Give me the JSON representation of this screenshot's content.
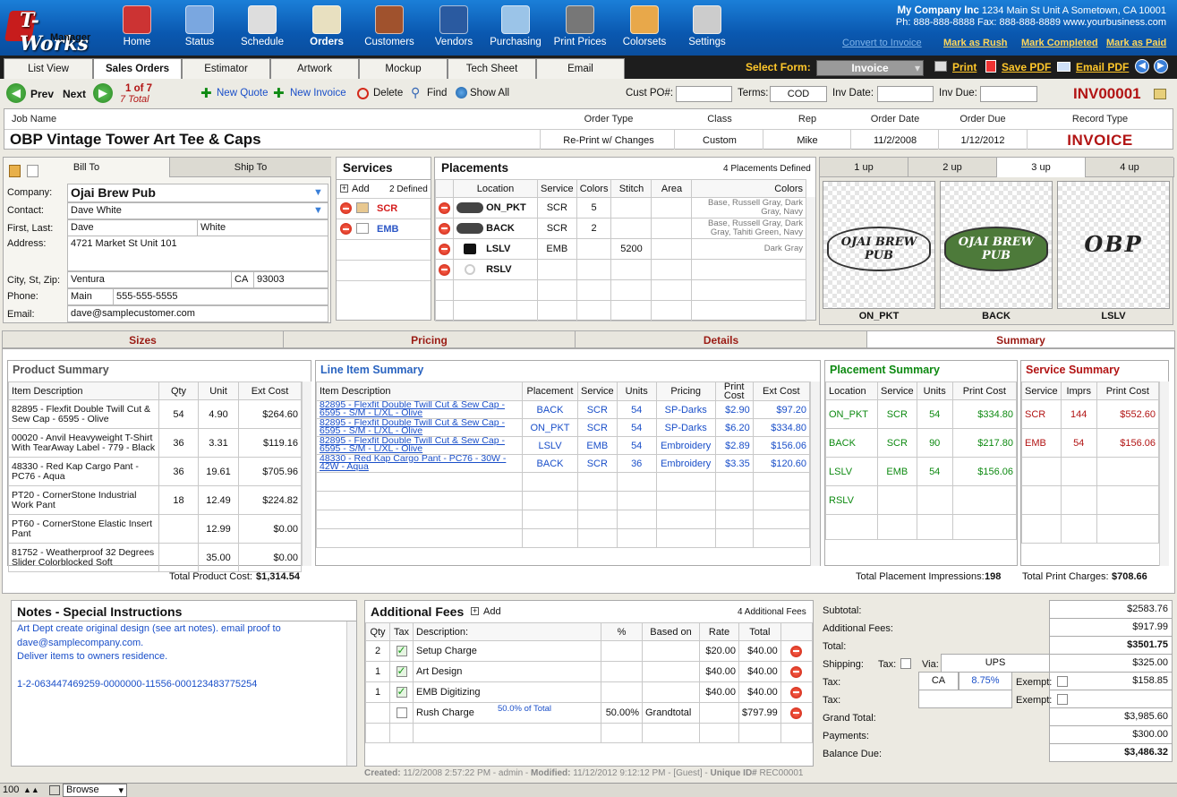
{
  "app": {
    "logo_main": "T-Works",
    "logo_sub": "Manager"
  },
  "toolbar": [
    {
      "label": "Home",
      "icon": "home-icon",
      "color": "#c33"
    },
    {
      "label": "Status",
      "icon": "flag-icon",
      "color": "#7aa7e0"
    },
    {
      "label": "Schedule",
      "icon": "calendar-icon",
      "color": "#ddd",
      "extra": "30"
    },
    {
      "label": "Orders",
      "icon": "orders-icon",
      "color": "#e8e0c0"
    },
    {
      "label": "Customers",
      "icon": "address-book-icon",
      "color": "#a0522d"
    },
    {
      "label": "Vendors",
      "icon": "shirt-icon",
      "color": "#2a5aa0"
    },
    {
      "label": "Purchasing",
      "icon": "basket-icon",
      "color": "#9bc4e8"
    },
    {
      "label": "Print Prices",
      "icon": "calculator-icon",
      "color": "#777"
    },
    {
      "label": "Colorsets",
      "icon": "palette-icon",
      "color": "#e8a84a"
    },
    {
      "label": "Settings",
      "icon": "settings-icon",
      "color": "#ccc"
    }
  ],
  "company": {
    "name": "My Company Inc",
    "address": "1234 Main St Unit A Sometown, CA 10001",
    "phone": "Ph: 888-888-8888 Fax: 888-888-8889 www.yourbusiness.com"
  },
  "top_links": {
    "convert": "Convert to Invoice",
    "rush": "Mark as Rush",
    "completed": "Mark Completed",
    "paid": "Mark as Paid"
  },
  "tabs": [
    "List View",
    "Sales Orders",
    "Estimator",
    "Artwork",
    "Mockup",
    "Tech Sheet",
    "Email"
  ],
  "form": {
    "select_label": "Select Form:",
    "selected": "Invoice",
    "print": "Print",
    "save_pdf": "Save PDF",
    "email_pdf": "Email PDF"
  },
  "nav": {
    "prev": "Prev",
    "next": "Next",
    "record": "1 of 7",
    "total": "7 Total",
    "new_quote": "New Quote",
    "new_invoice": "New Invoice",
    "delete": "Delete",
    "find": "Find",
    "show_all": "Show All",
    "cust_po_label": "Cust PO#:",
    "cust_po": "",
    "terms_label": "Terms:",
    "terms": "COD",
    "inv_date_label": "Inv Date:",
    "inv_date": "",
    "inv_due_label": "Inv Due:",
    "inv_due": "",
    "invoice_no": "INV00001"
  },
  "job": {
    "h_job": "Job Name",
    "h_type": "Order Type",
    "h_class": "Class",
    "h_rep": "Rep",
    "h_odate": "Order Date",
    "h_odue": "Order Due",
    "h_rtype": "Record Type",
    "name": "OBP Vintage Tower Art Tee & Caps",
    "type": "Re-Print w/ Changes",
    "class": "Custom",
    "rep": "Mike",
    "order_date": "11/2/2008",
    "order_due": "1/12/2012",
    "record_type": "INVOICE"
  },
  "customer": {
    "tab_bill": "Bill To",
    "tab_ship": "Ship To",
    "company_label": "Company:",
    "company": "Ojai Brew Pub",
    "contact_label": "Contact:",
    "contact": "Dave White",
    "name_label": "First, Last:",
    "first": "Dave",
    "last": "White",
    "address_label": "Address:",
    "address": "4721 Market St Unit 101",
    "city_label": "City, St, Zip:",
    "city": "Ventura",
    "state": "CA",
    "zip": "93003",
    "phone_label": "Phone:",
    "phone_type": "Main",
    "phone": "555-555-5555",
    "email_label": "Email:",
    "email": "dave@samplecustomer.com"
  },
  "services": {
    "title": "Services",
    "add": "Add",
    "defined": "2 Defined",
    "items": [
      {
        "name": "SCR",
        "color": "#d41c1c"
      },
      {
        "name": "EMB",
        "color": "#2b56c6"
      }
    ]
  },
  "placements": {
    "title": "Placements",
    "defined": "4 Placements Defined",
    "headers": [
      "Location",
      "Service",
      "Colors",
      "Stitch",
      "Area",
      "Colors"
    ],
    "rows": [
      {
        "loc": "ON_PKT",
        "service": "SCR",
        "colors": "5",
        "stitch": "",
        "area": "",
        "colorlist": "Base, Russell Gray, Dark Gray, Navy"
      },
      {
        "loc": "BACK",
        "service": "SCR",
        "colors": "2",
        "stitch": "",
        "area": "",
        "colorlist": "Base, Russell Gray, Dark Gray, Tahiti Green, Navy"
      },
      {
        "loc": "LSLV",
        "service": "EMB",
        "colors": "",
        "stitch": "5200",
        "area": "",
        "colorlist": "Dark Gray"
      },
      {
        "loc": "RSLV",
        "service": "",
        "colors": "",
        "stitch": "",
        "area": "",
        "colorlist": ""
      }
    ]
  },
  "previews": {
    "tabs": [
      "1 up",
      "2 up",
      "3 up",
      "4 up"
    ],
    "items": [
      {
        "label": "ON_PKT",
        "art": "OJAI BREW PUB"
      },
      {
        "label": "BACK",
        "art": "OJAI BREW PUB"
      },
      {
        "label": "LSLV",
        "art": "OBP"
      }
    ]
  },
  "subtabs": [
    "Sizes",
    "Pricing",
    "Details",
    "Summary"
  ],
  "product_summary": {
    "title": "Product Summary",
    "headers": [
      "Item Description",
      "Qty",
      "Unit",
      "Ext Cost"
    ],
    "rows": [
      {
        "desc": "82895 - Flexfit Double Twill Cut & Sew Cap - 6595 - Olive",
        "qty": "54",
        "unit": "4.90",
        "ext": "$264.60"
      },
      {
        "desc": "00020 - Anvil Heavyweight T-Shirt With TearAway Label - 779 - Black",
        "qty": "36",
        "unit": "3.31",
        "ext": "$119.16"
      },
      {
        "desc": "48330 - Red Kap Cargo Pant - PC76 - Aqua",
        "qty": "36",
        "unit": "19.61",
        "ext": "$705.96"
      },
      {
        "desc": "PT20 - CornerStone Industrial Work Pant",
        "qty": "18",
        "unit": "12.49",
        "ext": "$224.82"
      },
      {
        "desc": "PT60 - CornerStone Elastic Insert Pant",
        "qty": "",
        "unit": "12.99",
        "ext": "$0.00"
      },
      {
        "desc": "81752 - Weatherproof 32 Degrees Slider Colorblocked Soft",
        "qty": "",
        "unit": "35.00",
        "ext": "$0.00"
      }
    ],
    "total_label": "Total Product Cost:",
    "total": "$1,314.54"
  },
  "line_item_summary": {
    "title": "Line Item Summary",
    "headers": [
      "Item Description",
      "Placement",
      "Service",
      "Units",
      "Pricing",
      "Print Cost",
      "Ext Cost"
    ],
    "rows": [
      {
        "desc": "82895 - Flexfit Double Twill Cut & Sew Cap - 6595 - S/M - L/XL - Olive",
        "placement": "BACK",
        "service": "SCR",
        "units": "54",
        "pricing": "SP-Darks",
        "print": "$2.90",
        "ext": "$97.20"
      },
      {
        "desc": "82895 - Flexfit Double Twill Cut & Sew Cap - 6595 - S/M - L/XL - Olive",
        "placement": "ON_PKT",
        "service": "SCR",
        "units": "54",
        "pricing": "SP-Darks",
        "print": "$6.20",
        "ext": "$334.80"
      },
      {
        "desc": "82895 - Flexfit Double Twill Cut & Sew Cap - 6595 - S/M - L/XL - Olive",
        "placement": "LSLV",
        "service": "EMB",
        "units": "54",
        "pricing": "Embroidery",
        "print": "$2.89",
        "ext": "$156.06"
      },
      {
        "desc": "48330 - Red Kap Cargo Pant - PC76 - 30W - 42W - Aqua",
        "placement": "BACK",
        "service": "SCR",
        "units": "36",
        "pricing": "Embroidery",
        "print": "$3.35",
        "ext": "$120.60"
      }
    ]
  },
  "placement_summary": {
    "title": "Placement Summary",
    "headers": [
      "Location",
      "Service",
      "Units",
      "Print Cost"
    ],
    "rows": [
      {
        "loc": "ON_PKT",
        "service": "SCR",
        "units": "54",
        "cost": "$334.80"
      },
      {
        "loc": "BACK",
        "service": "SCR",
        "units": "90",
        "cost": "$217.80"
      },
      {
        "loc": "LSLV",
        "service": "EMB",
        "units": "54",
        "cost": "$156.06"
      },
      {
        "loc": "RSLV",
        "service": "",
        "units": "",
        "cost": ""
      }
    ],
    "total_label": "Total Placement Impressions:",
    "total": "198"
  },
  "service_summary": {
    "title": "Service Summary",
    "headers": [
      "Service",
      "Imprs",
      "Print Cost"
    ],
    "rows": [
      {
        "service": "SCR",
        "imprs": "144",
        "cost": "$552.60"
      },
      {
        "service": "EMB",
        "imprs": "54",
        "cost": "$156.06"
      }
    ],
    "total_label": "Total Print Charges:",
    "total": "$708.66"
  },
  "notes": {
    "title": "Notes - Special Instructions",
    "lines": [
      "Art Dept create original design (see art notes). email proof to",
      "dave@samplecompany.com.",
      "Deliver items to owners residence.",
      "",
      "1-2-063447469259-0000000-11556-000123483775254"
    ]
  },
  "fees": {
    "title": "Additional Fees",
    "add": "Add",
    "count": "4 Additional Fees",
    "headers": [
      "Qty",
      "Tax",
      "Description:",
      "%",
      "Based on",
      "Rate",
      "Total"
    ],
    "rows": [
      {
        "qty": "2",
        "tax": true,
        "desc": "Setup Charge",
        "pct": "",
        "based": "",
        "rate": "$20.00",
        "total": "$40.00"
      },
      {
        "qty": "1",
        "tax": true,
        "desc": "Art Design",
        "pct": "",
        "based": "",
        "rate": "$40.00",
        "total": "$40.00"
      },
      {
        "qty": "1",
        "tax": true,
        "desc": "EMB Digitizing",
        "pct": "",
        "based": "",
        "rate": "$40.00",
        "total": "$40.00"
      },
      {
        "qty": "",
        "tax": false,
        "desc": "Rush Charge",
        "note": "50.0% of Total",
        "pct": "50.00%",
        "based": "Grandtotal",
        "rate": "",
        "total": "$797.99"
      }
    ]
  },
  "totals": {
    "subtotal_label": "Subtotal:",
    "subtotal": "$2583.76",
    "fees_label": "Additional Fees:",
    "fees": "$917.99",
    "total_label": "Total:",
    "total": "$3501.75",
    "shipping_label": "Shipping:",
    "tax_chk_label": "Tax:",
    "via_label": "Via:",
    "via": "UPS",
    "shipping": "$325.00",
    "tax_label": "Tax:",
    "tax_state": "CA",
    "tax_rate": "8.75%",
    "exempt_label": "Exempt:",
    "tax": "$158.85",
    "tax2_label": "Tax:",
    "tax2": "",
    "grand_label": "Grand Total:",
    "grand": "$3,985.60",
    "payments_label": "Payments:",
    "payments": "$300.00",
    "balance_label": "Balance Due:",
    "balance": "$3,486.32"
  },
  "footer": {
    "created_label": "Created:",
    "created": "11/2/2008 2:57:22 PM - admin",
    "modified_label": "Modified:",
    "modified": "11/12/2012 9:12:12 PM - [Guest]",
    "uid_label": "Unique ID#",
    "uid": "REC00001",
    "zoom": "100",
    "mode": "Browse"
  }
}
